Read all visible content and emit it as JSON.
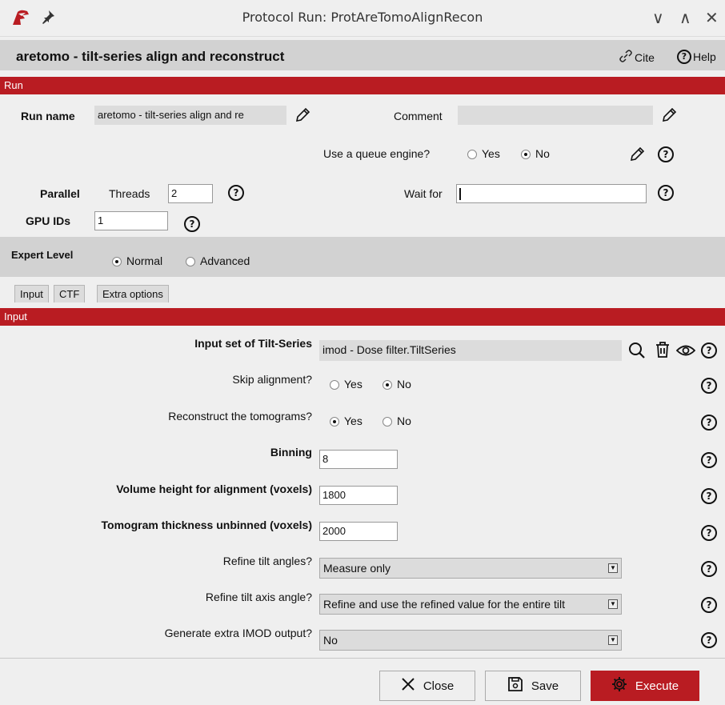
{
  "window": {
    "title": "Protocol Run: ProtAreTomoAlignRecon",
    "controls": [
      "∨",
      "∧",
      "✕"
    ]
  },
  "header": {
    "title": "aretomo - tilt-series align and reconstruct",
    "cite_label": "Cite",
    "help_label": "Help"
  },
  "run_section": {
    "bar_label": "Run",
    "run_name_label": "Run name",
    "run_name_value": "aretomo - tilt-series align and re",
    "comment_label": "Comment",
    "comment_value": "",
    "queue_label": "Use a queue engine?",
    "queue_options": [
      "Yes",
      "No"
    ],
    "queue_selected": "No",
    "parallel_label": "Parallel",
    "threads_label": "Threads",
    "threads_value": "2",
    "wait_for_label": "Wait for",
    "wait_for_value": "",
    "gpu_label": "GPU IDs",
    "gpu_value": "1"
  },
  "expert": {
    "label": "Expert Level",
    "options": [
      "Normal",
      "Advanced"
    ],
    "selected": "Normal"
  },
  "tabs": [
    "Input",
    "CTF",
    "Extra options"
  ],
  "input_section": {
    "bar_label": "Input",
    "tilt_series_label": "Input set of Tilt-Series",
    "tilt_series_value": "imod - Dose filter.TiltSeries",
    "skip_alignment_label": "Skip alignment?",
    "skip_alignment_options": [
      "Yes",
      "No"
    ],
    "skip_alignment_selected": "No",
    "reconstruct_label": "Reconstruct the tomograms?",
    "reconstruct_options": [
      "Yes",
      "No"
    ],
    "reconstruct_selected": "Yes",
    "binning_label": "Binning",
    "binning_value": "8",
    "volume_height_label": "Volume height for alignment (voxels)",
    "volume_height_value": "1800",
    "tomo_thickness_label": "Tomogram thickness unbinned (voxels)",
    "tomo_thickness_value": "2000",
    "refine_tilt_label": "Refine tilt angles?",
    "refine_tilt_value": "Measure only",
    "refine_axis_label": "Refine tilt axis angle?",
    "refine_axis_value": "Refine and use the refined value for the entire tilt",
    "imod_output_label": "Generate extra IMOD output?",
    "imod_output_value": "No"
  },
  "footer": {
    "close_label": "Close",
    "save_label": "Save",
    "execute_label": "Execute"
  },
  "colors": {
    "accent": "#b91c22",
    "background": "#efefef",
    "header_bg": "#d2d2d2"
  }
}
